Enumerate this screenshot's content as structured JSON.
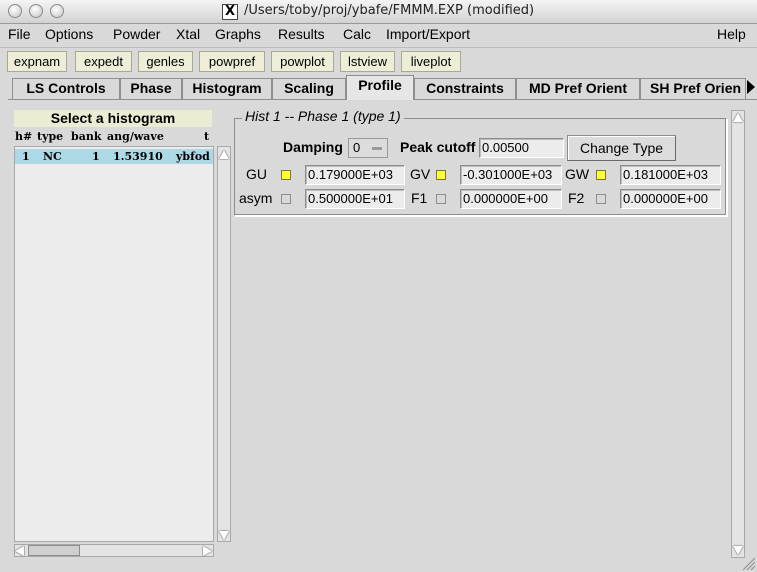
{
  "window": {
    "title": "/Users/toby/proj/ybafe/FMMM.EXP (modified)",
    "x_icon_glyph": "X"
  },
  "menu": {
    "items": [
      "File",
      "Options",
      "Powder",
      "Xtal",
      "Graphs",
      "Results",
      "Calc",
      "Import/Export"
    ],
    "help": "Help"
  },
  "toolbar": {
    "buttons": [
      "expnam",
      "expedt",
      "genles",
      "powpref",
      "powplot",
      "lstview",
      "liveplot"
    ]
  },
  "tabs": {
    "items": [
      "LS Controls",
      "Phase",
      "Histogram",
      "Scaling",
      "Profile",
      "Constraints",
      "MD Pref Orient",
      "SH Pref Orien"
    ],
    "active": "Profile"
  },
  "histogram_list": {
    "title": "Select a histogram",
    "headers": {
      "num": "h#",
      "type": "type",
      "bank": "bank",
      "angwave": "ang/wave",
      "t": "t"
    },
    "rows": [
      {
        "num": "1",
        "type": "NC",
        "bank": "1",
        "angwave": "1.53910",
        "t": "ybfod"
      }
    ]
  },
  "profile": {
    "frame_title": "Hist 1 -- Phase 1 (type 1)",
    "damping_label": "Damping",
    "damping_value": "0",
    "peak_cutoff_label": "Peak cutoff",
    "peak_cutoff_value": "0.00500",
    "change_type_label": "Change Type",
    "params": {
      "GU": {
        "label": "GU",
        "value": "0.179000E+03",
        "refine": true
      },
      "GV": {
        "label": "GV",
        "value": "-0.301000E+03",
        "refine": true
      },
      "GW": {
        "label": "GW",
        "value": "0.181000E+03",
        "refine": true
      },
      "asym": {
        "label": "asym",
        "value": "0.500000E+01",
        "refine": false
      },
      "F1": {
        "label": "F1",
        "value": "0.000000E+00",
        "refine": false
      },
      "F2": {
        "label": "F2",
        "value": "0.000000E+00",
        "refine": false
      }
    }
  },
  "colors": {
    "selected_row": "#add8e6",
    "checkbox_on": "#ffff33",
    "toolbar_button": "#eeeed8"
  }
}
